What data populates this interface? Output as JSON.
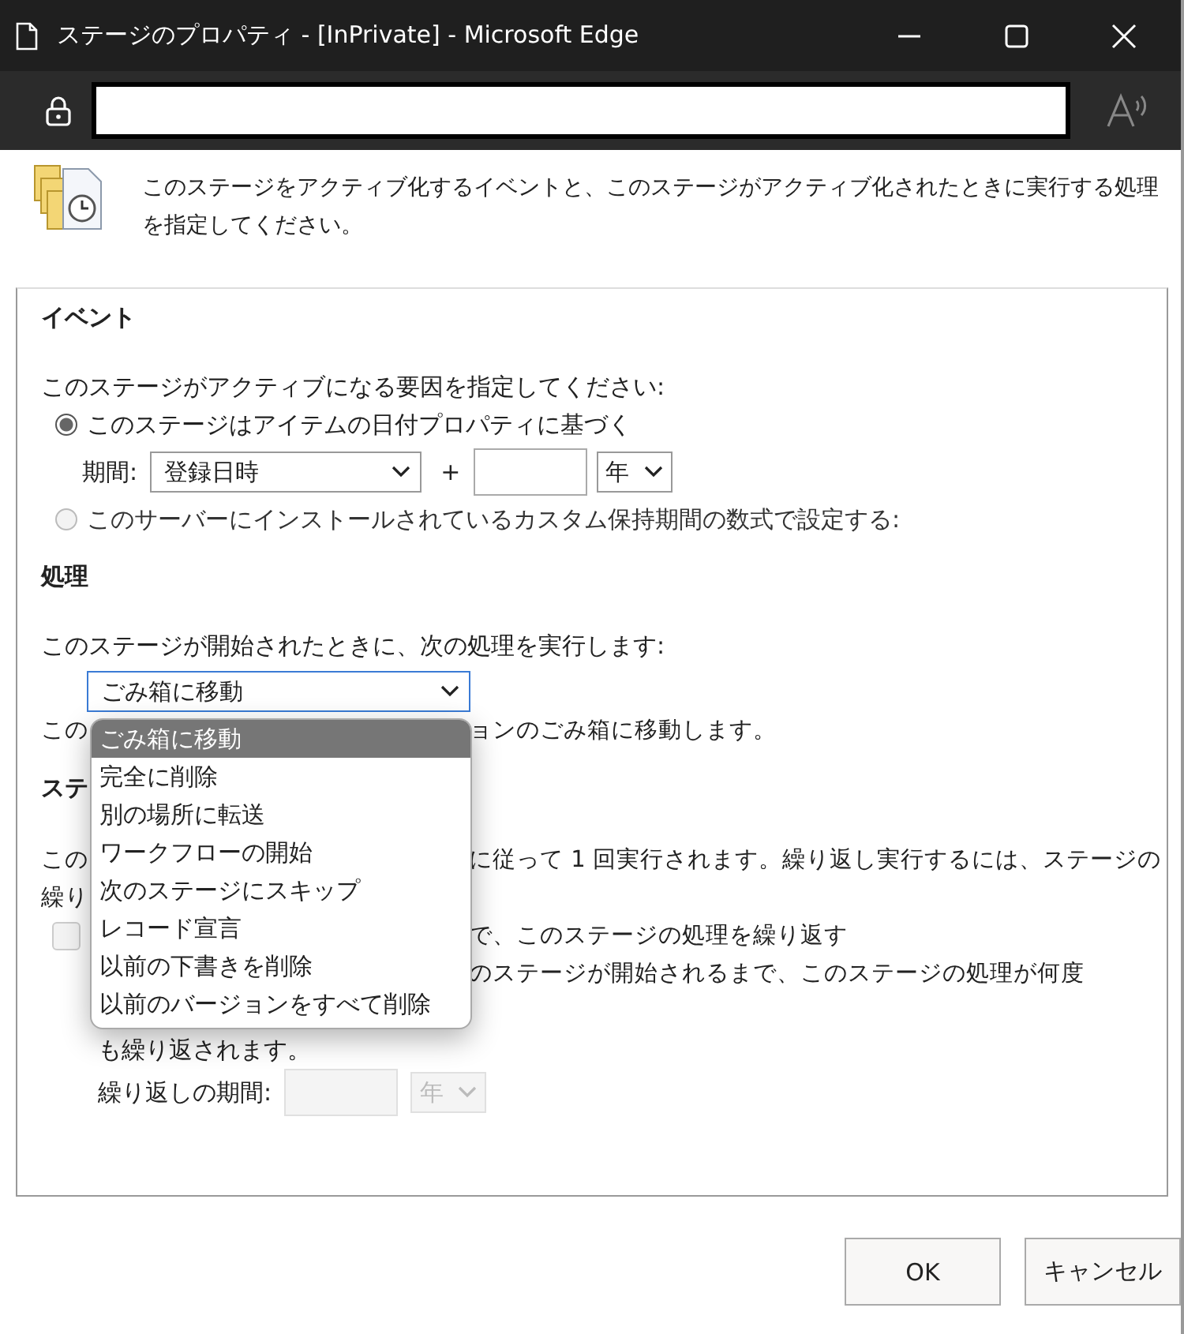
{
  "window": {
    "title": "ステージのプロパティ - [InPrivate] - Microsoft Edge"
  },
  "intro": "このステージをアクティブ化するイベントと、このステージがアクティブ化されたときに実行する処理を指定してください。",
  "event_section": {
    "heading": "イベント",
    "prompt": "このステージがアクティブになる要因を指定してください:",
    "options": [
      {
        "label": "このステージはアイテムの日付プロパティに基づく",
        "selected": true
      },
      {
        "label": "このサーバーにインストールされているカスタム保持期間の数式で設定する:",
        "selected": false
      }
    ],
    "period": {
      "label": "期間:",
      "property": "登録日時",
      "plus": "+",
      "unit": "年"
    }
  },
  "action_section": {
    "heading": "処理",
    "prompt": "このステージが開始されたときに、次の処理を実行します:",
    "value": "ごみ箱に移動",
    "expanded": true,
    "options": [
      {
        "label": "ごみ箱に移動",
        "selected": true
      },
      {
        "label": "完全に削除",
        "selected": false
      },
      {
        "label": "別の場所に転送",
        "selected": false
      },
      {
        "label": "ワークフローの開始",
        "selected": false
      },
      {
        "label": "次のステージにスキップ",
        "selected": false
      },
      {
        "label": "レコード宣言",
        "selected": false
      },
      {
        "label": "以前の下書きを削除",
        "selected": false
      },
      {
        "label": "以前のバージョンをすべて削除",
        "selected": false
      }
    ],
    "description": {
      "left": "この",
      "right": "ョンのごみ箱に移動します。"
    }
  },
  "recurrence_section": {
    "heading": "ステ",
    "lines": [
      {
        "left": "この",
        "right": "に従って 1 回実行されます。繰り返し実行するには、ステージの"
      },
      {
        "left": "繰り"
      }
    ],
    "repeat": {
      "checked": false,
      "label_lines": [
        "で、このステージの処理を繰り返す",
        "のステージが開始されるまで、このステージの処理が何度"
      ],
      "note": "も繰り返されます。"
    },
    "period_label": "繰り返しの期間:",
    "unit": "年"
  },
  "buttons": [
    "OK",
    "キャンセル"
  ]
}
